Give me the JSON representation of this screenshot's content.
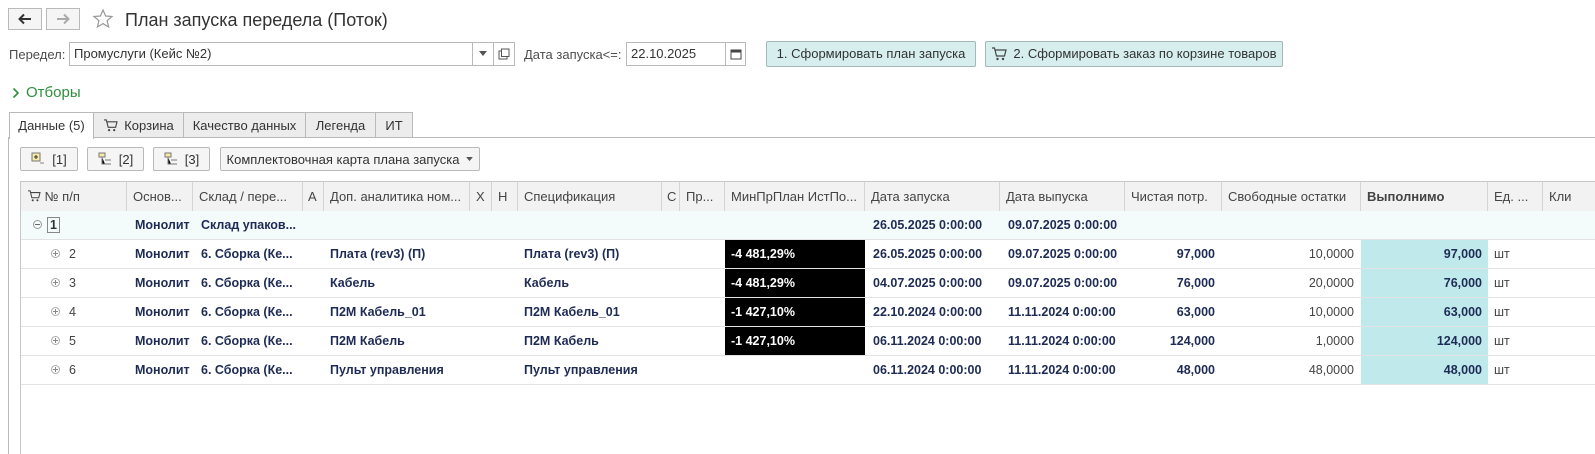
{
  "header": {
    "title": "План запуска передела (Поток)"
  },
  "form": {
    "peredel_label": "Передел:",
    "peredel_value": "Промуслуги (Кейс №2)",
    "date_label": "Дата запуска<=:",
    "date_value": "22.10.2025",
    "btn_plan": "1. Сформировать план запуска",
    "btn_order": "2. Сформировать заказ по корзине товаров"
  },
  "filters_label": "Отборы",
  "tabs": [
    {
      "label": "Данные (5)"
    },
    {
      "label": "Корзина"
    },
    {
      "label": "Качество данных"
    },
    {
      "label": "Легенда"
    },
    {
      "label": "ИТ"
    }
  ],
  "toolbar": {
    "b1": "[1]",
    "b2": "[2]",
    "b3": "[3]",
    "card": "Комплектовочная карта плана запуска"
  },
  "columns": [
    "№ п/п",
    "Основ...",
    "Склад / пере...",
    "А",
    "Доп. аналитика ном...",
    "Х",
    "Н",
    "Спецификация",
    "С",
    "Пр...",
    "МинПрПлан ИстПо...",
    "Дата запуска",
    "Дата выпуска",
    "Чистая потр.",
    "Свободные остатки",
    "Выполнимо",
    "Ед. ...",
    "Кли"
  ],
  "group_row": {
    "num": "1",
    "base": "Монолит",
    "sklad": "Склад упаков...",
    "date_start": "26.05.2025 0:00:00",
    "date_end": "09.07.2025 0:00:00"
  },
  "rows": [
    {
      "num": "2",
      "base": "Монолит",
      "sklad": "6. Сборка (Ке...",
      "dop": "Плата (rev3) (П)",
      "spec": "Плата (rev3) (П)",
      "min": "-4 481,29%",
      "date_start": "26.05.2025 0:00:00",
      "date_end": "09.07.2025 0:00:00",
      "need": "97,000",
      "free": "10,0000",
      "done": "97,000",
      "unit": "шт"
    },
    {
      "num": "3",
      "base": "Монолит",
      "sklad": "6. Сборка (Ке...",
      "dop": "Кабель",
      "spec": "Кабель",
      "min": "-4 481,29%",
      "date_start": "04.07.2025 0:00:00",
      "date_end": "09.07.2025 0:00:00",
      "need": "76,000",
      "free": "20,0000",
      "done": "76,000",
      "unit": "шт"
    },
    {
      "num": "4",
      "base": "Монолит",
      "sklad": "6. Сборка (Ке...",
      "dop": "П2М Кабель_01",
      "spec": "П2М Кабель_01",
      "min": "-1 427,10%",
      "date_start": "22.10.2024 0:00:00",
      "date_end": "11.11.2024 0:00:00",
      "need": "63,000",
      "free": "10,0000",
      "done": "63,000",
      "unit": "шт"
    },
    {
      "num": "5",
      "base": "Монолит",
      "sklad": "6. Сборка (Ке...",
      "dop": "П2М Кабель",
      "spec": "П2М Кабель",
      "min": "-1 427,10%",
      "date_start": "06.11.2024 0:00:00",
      "date_end": "11.11.2024 0:00:00",
      "need": "124,000",
      "free": "1,0000",
      "done": "124,000",
      "unit": "шт"
    },
    {
      "num": "6",
      "base": "Монолит",
      "sklad": "6. Сборка (Ке...",
      "dop": "Пульт управления",
      "spec": "Пульт управления",
      "min": "",
      "date_start": "06.11.2024 0:00:00",
      "date_end": "11.11.2024 0:00:00",
      "need": "48,000",
      "free": "48,0000",
      "done": "48,000",
      "unit": "шт"
    }
  ],
  "colors": {
    "accent_button": "#d6eeee",
    "filters_green": "#2f8e3e",
    "highlight_col": "#bfe9ea",
    "negative_cell": "#000000"
  }
}
